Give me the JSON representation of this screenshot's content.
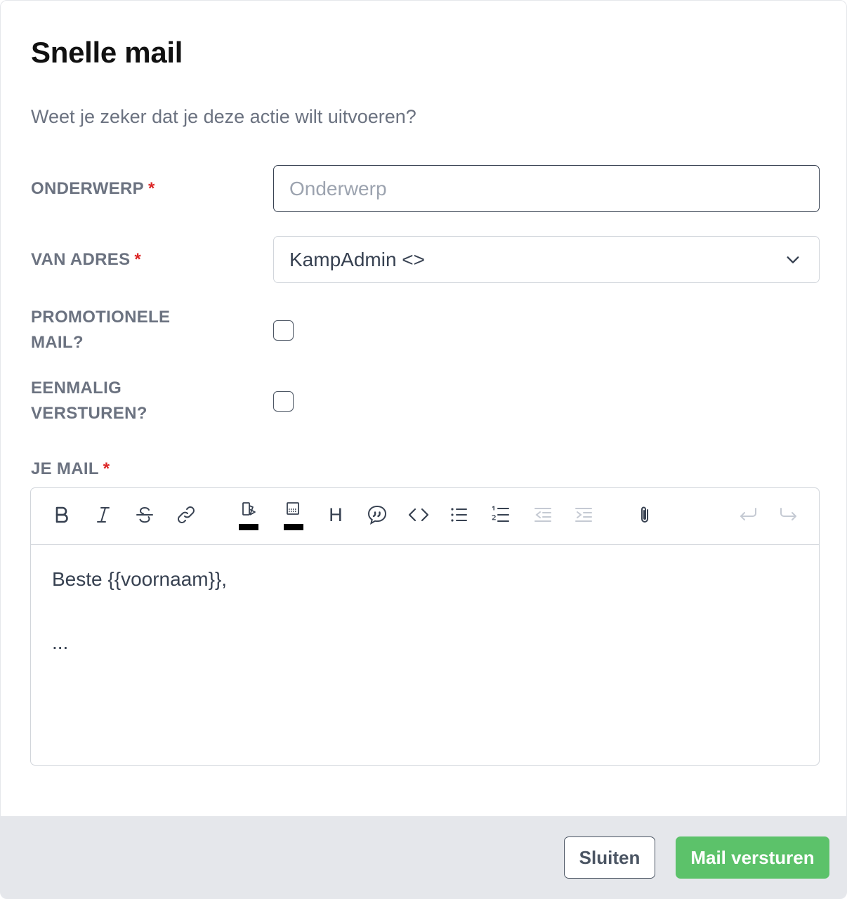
{
  "dialog": {
    "title": "Snelle mail",
    "subtitle": "Weet je zeker dat je deze actie wilt uitvoeren?"
  },
  "form": {
    "subject": {
      "label": "ONDERWERP",
      "required_mark": "*",
      "placeholder": "Onderwerp",
      "value": ""
    },
    "from": {
      "label": "VAN ADRES",
      "required_mark": "*",
      "selected": "KampAdmin <>"
    },
    "promotional": {
      "label_line1": "PROMOTIONELE",
      "label_line2": "MAIL?",
      "checked": false
    },
    "send_once": {
      "label_line1": "EENMALIG",
      "label_line2": "VERSTUREN?",
      "checked": false
    },
    "mail": {
      "label": "JE MAIL",
      "required_mark": "*"
    }
  },
  "editor": {
    "toolbar": [
      "bold-icon",
      "italic-icon",
      "strikethrough-icon",
      "link-icon",
      "text-color-icon",
      "highlight-color-icon",
      "heading-icon",
      "quote-icon",
      "code-icon",
      "bullet-list-icon",
      "numbered-list-icon",
      "outdent-icon",
      "indent-icon",
      "attachment-icon",
      "undo-icon",
      "redo-icon"
    ],
    "heading_glyph": "H",
    "text_color": "#000000",
    "highlight_color": "#000000",
    "content_line1": "Beste {{voornaam}},",
    "content_line2": "..."
  },
  "footer": {
    "close_label": "Sluiten",
    "send_label": "Mail versturen",
    "send_color": "#5cc26a"
  }
}
